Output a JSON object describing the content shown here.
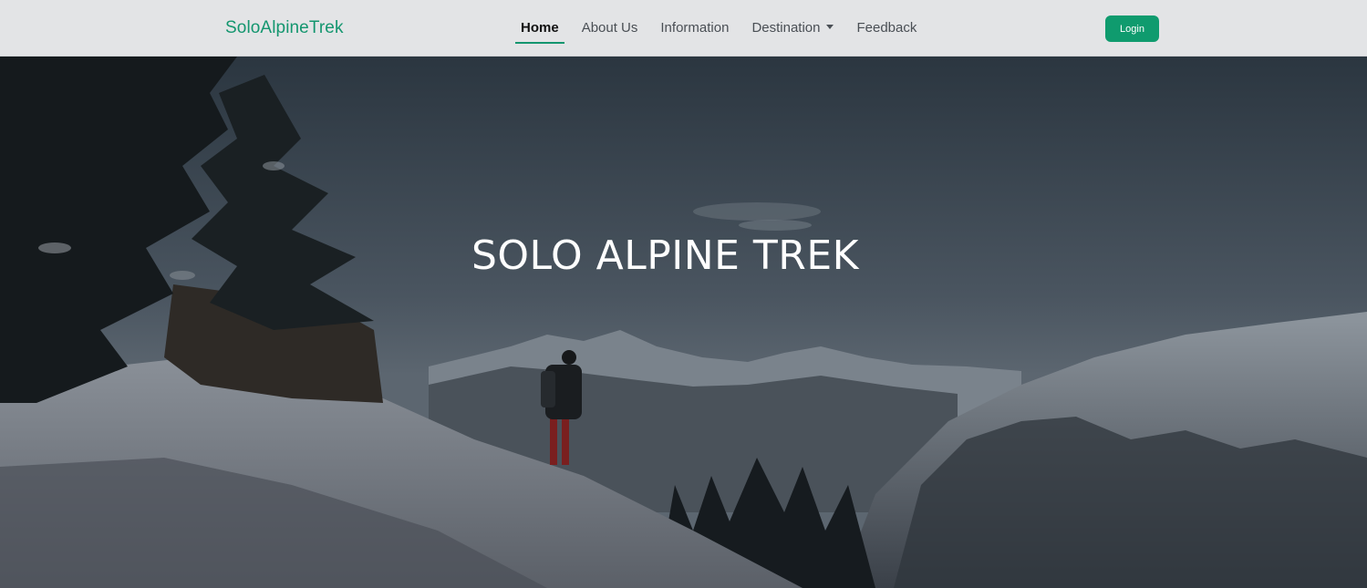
{
  "navbar": {
    "brand": "SoloAlpineTrek",
    "links": [
      {
        "label": "Home",
        "active": true
      },
      {
        "label": "About Us"
      },
      {
        "label": "Information"
      },
      {
        "label": "Destination",
        "dropdown": true
      },
      {
        "label": "Feedback"
      }
    ],
    "login_label": "Login"
  },
  "hero": {
    "title": "SOLO ALPINE TREK"
  },
  "colors": {
    "accent": "#0f9b6e",
    "brand_text": "#14966f",
    "navbar_bg": "#e3e4e6",
    "hero_overlay": "#1f262c"
  }
}
